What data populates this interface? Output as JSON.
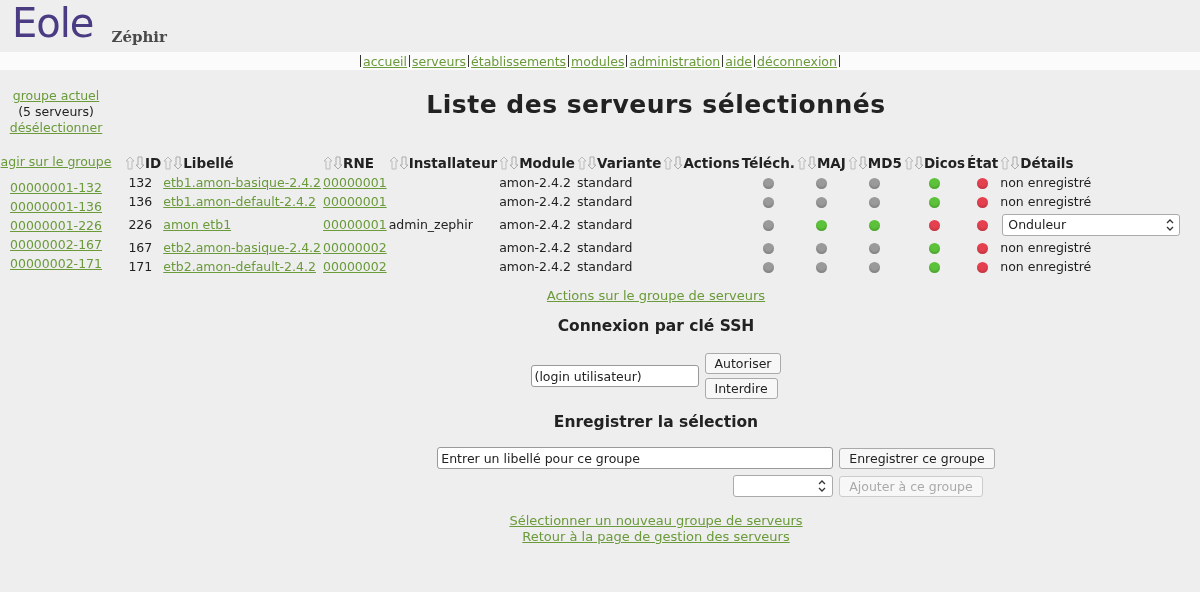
{
  "header": {
    "logo": "Eole",
    "app_name": "Zéphir"
  },
  "nav": [
    "accueil",
    "serveurs",
    "établissements",
    "modules",
    "administration",
    "aide",
    "déconnexion"
  ],
  "sidebar": {
    "group_link": "groupe actuel",
    "group_count": "(5 serveurs)",
    "deselect": "désélectionner",
    "act_link": "agir sur le groupe",
    "servers": [
      "00000001-132",
      "00000001-136",
      "00000001-226",
      "00000002-167",
      "00000002-171"
    ]
  },
  "title": "Liste des serveurs sélectionnés",
  "table": {
    "columns": [
      {
        "label": "ID",
        "sortable": true
      },
      {
        "label": "Libellé",
        "sortable": true
      },
      {
        "label": "RNE",
        "sortable": true
      },
      {
        "label": "Installateur",
        "sortable": true
      },
      {
        "label": "Module",
        "sortable": true
      },
      {
        "label": "Variante",
        "sortable": true
      },
      {
        "label": "Actions",
        "sortable": true
      },
      {
        "label": "Téléch.",
        "sortable": false
      },
      {
        "label": "MAJ",
        "sortable": true
      },
      {
        "label": "MD5",
        "sortable": true
      },
      {
        "label": "Dicos",
        "sortable": true
      },
      {
        "label": "État",
        "sortable": false
      },
      {
        "label": "Détails",
        "sortable": true
      }
    ],
    "rows": [
      {
        "id": "132",
        "libelle": "etb1.amon-basique-2.4.2",
        "rne": "00000001",
        "module": "amon-2.4.2",
        "variante": "standard",
        "status": [
          {
            "color": "#9a9a9a"
          },
          {
            "color": "#9a9a9a"
          },
          {
            "color": "#9a9a9a"
          },
          {
            "color": "#5cc23a"
          },
          {
            "color": "#e5404f"
          }
        ],
        "details": {
          "kind": "text",
          "text": "non enregistré"
        }
      },
      {
        "id": "136",
        "libelle": "etb1.amon-default-2.4.2",
        "rne": "00000001",
        "module": "amon-2.4.2",
        "variante": "standard",
        "status": [
          {
            "color": "#9a9a9a"
          },
          {
            "color": "#9a9a9a"
          },
          {
            "color": "#9a9a9a"
          },
          {
            "color": "#5cc23a"
          },
          {
            "color": "#e5404f"
          }
        ],
        "details": {
          "kind": "text",
          "text": "non enregistré"
        }
      },
      {
        "id": "226",
        "libelle": "amon etb1",
        "rne": "00000001",
        "installateur": "admin_zephir",
        "module": "amon-2.4.2",
        "variante": "standard",
        "status": [
          {
            "color": "#9a9a9a"
          },
          {
            "color": "#5cc23a"
          },
          {
            "color": "#5cc23a"
          },
          {
            "color": "#e5404f"
          },
          {
            "color": "#e5404f"
          }
        ],
        "details": {
          "kind": "select",
          "text": "Onduleur"
        }
      },
      {
        "id": "167",
        "libelle": "etb2.amon-basique-2.4.2",
        "rne": "00000002",
        "module": "amon-2.4.2",
        "variante": "standard",
        "status": [
          {
            "color": "#9a9a9a"
          },
          {
            "color": "#9a9a9a"
          },
          {
            "color": "#9a9a9a"
          },
          {
            "color": "#5cc23a"
          },
          {
            "color": "#e5404f"
          }
        ],
        "details": {
          "kind": "text",
          "text": "non enregistré"
        }
      },
      {
        "id": "171",
        "libelle": "etb2.amon-default-2.4.2",
        "rne": "00000002",
        "module": "amon-2.4.2",
        "variante": "standard",
        "status": [
          {
            "color": "#9a9a9a"
          },
          {
            "color": "#9a9a9a"
          },
          {
            "color": "#9a9a9a"
          },
          {
            "color": "#5cc23a"
          },
          {
            "color": "#e5404f"
          }
        ],
        "details": {
          "kind": "text",
          "text": "non enregistré"
        }
      }
    ]
  },
  "group_actions_link": "Actions sur le groupe de serveurs",
  "ssh": {
    "heading": "Connexion par clé SSH",
    "login": "(login utilisateur)",
    "buttons": [
      "Autoriser",
      "Interdire"
    ]
  },
  "save": {
    "heading": "Enregistrer la sélection",
    "label_field": "Entrer un libellé pour ce groupe",
    "save_button": "Enregistrer ce groupe",
    "add_button": {
      "label": "Ajouter à ce groupe",
      "disabled": true
    }
  },
  "footer_links": [
    "Sélectionner un nouveau groupe de serveurs",
    "Retour à la page de gestion des serveurs"
  ]
}
